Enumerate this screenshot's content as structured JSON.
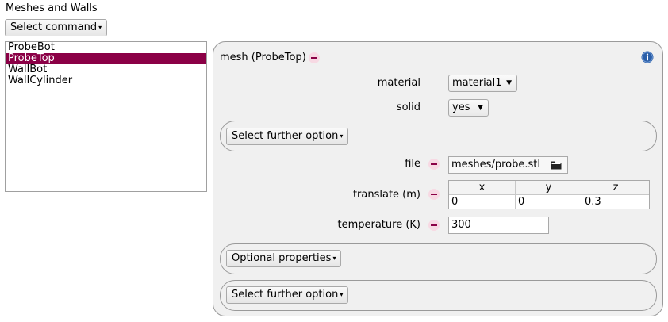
{
  "page": {
    "heading": "Meshes and Walls"
  },
  "toolbar": {
    "select_command_label": "Select command"
  },
  "list": {
    "items": [
      {
        "label": "ProbeBot"
      },
      {
        "label": "ProbeTop",
        "selected": true
      },
      {
        "label": "WallBot"
      },
      {
        "label": "WallCylinder"
      }
    ]
  },
  "panel": {
    "title": "mesh (ProbeTop)",
    "material": {
      "label": "material",
      "value": "material1"
    },
    "solid": {
      "label": "solid",
      "value": "yes"
    },
    "further_option_1": {
      "label": "Select further option"
    },
    "file": {
      "label": "file",
      "value": "meshes/probe.stl"
    },
    "translate": {
      "label": "translate (m)",
      "headers": [
        "x",
        "y",
        "z"
      ],
      "values": [
        "0",
        "0",
        "0.3"
      ]
    },
    "temperature": {
      "label": "temperature (K)",
      "value": "300"
    },
    "optional_properties": {
      "label": "Optional properties"
    },
    "further_option_2": {
      "label": "Select further option"
    }
  },
  "colors": {
    "accent": "#8b0046",
    "info": "#2a5ea8",
    "panel_bg": "#f0f0f0"
  },
  "icons": {
    "remove": "minus-icon",
    "info": "info-icon",
    "folder": "folder-icon",
    "dropdown": "chevron-down-icon"
  }
}
